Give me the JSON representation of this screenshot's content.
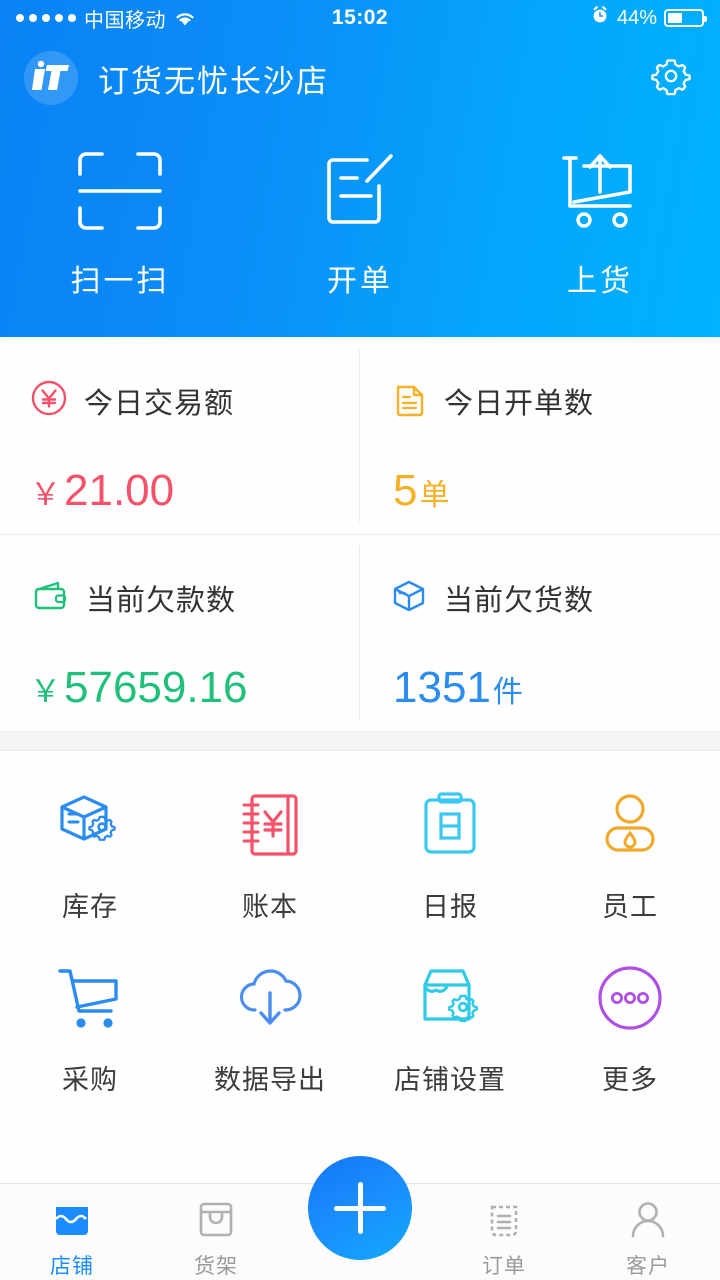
{
  "status_bar": {
    "signal_dots": 5,
    "carrier": "中国移动",
    "wifi_icon": "wifi-icon",
    "time": "15:02",
    "alarm_icon": "alarm-clock-icon",
    "battery_percent": "44%",
    "battery_level": 44
  },
  "app_bar": {
    "logo_icon": "app-logo-icon",
    "logo_text": "iT",
    "title": "订货无忧长沙店",
    "settings_icon": "gear-icon"
  },
  "quick_actions": [
    {
      "label": "扫一扫",
      "icon": "scan-qr-icon"
    },
    {
      "label": "开单",
      "icon": "create-order-icon"
    },
    {
      "label": "上货",
      "icon": "upload-goods-cart-icon"
    }
  ],
  "stats": [
    {
      "title": "今日交易额",
      "icon": "yuan-circle-icon",
      "currency": "￥",
      "value": "21.00",
      "unit": "",
      "color": "#f4526a"
    },
    {
      "title": "今日开单数",
      "icon": "document-icon",
      "currency": "",
      "value": "5",
      "unit": "单",
      "color": "#f5b125"
    },
    {
      "title": "当前欠款数",
      "icon": "wallet-icon",
      "currency": "￥",
      "value": "57659.16",
      "unit": "",
      "color": "#1fc07a"
    },
    {
      "title": "当前欠货数",
      "icon": "box-icon",
      "currency": "",
      "value": "1351",
      "unit": "件",
      "color": "#2b8cf0"
    }
  ],
  "menu_grid": [
    {
      "label": "库存",
      "icon": "box-gear-icon",
      "color": "#2b8cf0"
    },
    {
      "label": "账本",
      "icon": "ledger-yuan-icon",
      "color": "#f4526a"
    },
    {
      "label": "日报",
      "icon": "clipboard-day-icon",
      "color": "#3bc8f0"
    },
    {
      "label": "员工",
      "icon": "employee-icon",
      "color": "#f0a92a"
    },
    {
      "label": "采购",
      "icon": "shopping-cart-icon",
      "color": "#2b8cf0"
    },
    {
      "label": "数据导出",
      "icon": "cloud-download-icon",
      "color": "#4a8ef0"
    },
    {
      "label": "店铺设置",
      "icon": "shop-gear-icon",
      "color": "#2ecbe8"
    },
    {
      "label": "更多",
      "icon": "more-dots-icon",
      "color": "#b04ee8"
    }
  ],
  "tab_bar": {
    "items": [
      {
        "label": "店铺",
        "icon": "shop-icon",
        "active": true
      },
      {
        "label": "货架",
        "icon": "shelf-icon",
        "active": false
      },
      {
        "label": "订单",
        "icon": "order-icon",
        "active": false
      },
      {
        "label": "客户",
        "icon": "customer-icon",
        "active": false
      }
    ],
    "fab": {
      "icon": "plus-icon",
      "label": "+"
    }
  },
  "theme": {
    "header_gradient_start": "#0a82f5",
    "header_gradient_end": "#00b2ff",
    "accent": "#1a8cff",
    "tab_inactive": "#9a9a9a"
  }
}
